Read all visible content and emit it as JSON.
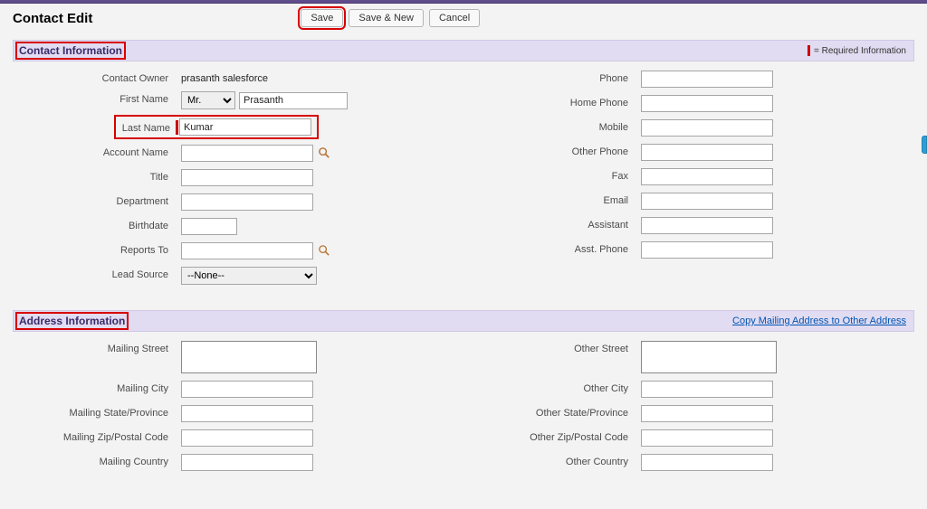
{
  "page": {
    "title": "Contact Edit"
  },
  "buttons": {
    "save": "Save",
    "save_new": "Save & New",
    "cancel": "Cancel"
  },
  "sections": {
    "contact_info": "Contact Information",
    "address_info": "Address Information",
    "required_legend": "= Required Information",
    "copy_link": "Copy Mailing Address to Other Address"
  },
  "labels": {
    "contact_owner": "Contact Owner",
    "first_name": "First Name",
    "last_name": "Last Name",
    "account_name": "Account Name",
    "title": "Title",
    "department": "Department",
    "birthdate": "Birthdate",
    "reports_to": "Reports To",
    "lead_source": "Lead Source",
    "phone": "Phone",
    "home_phone": "Home Phone",
    "mobile": "Mobile",
    "other_phone": "Other Phone",
    "fax": "Fax",
    "email": "Email",
    "assistant": "Assistant",
    "asst_phone": "Asst. Phone",
    "mailing_street": "Mailing Street",
    "mailing_city": "Mailing City",
    "mailing_state": "Mailing State/Province",
    "mailing_zip": "Mailing Zip/Postal Code",
    "mailing_country": "Mailing Country",
    "other_street": "Other Street",
    "other_city": "Other City",
    "other_state": "Other State/Province",
    "other_zip": "Other Zip/Postal Code",
    "other_country": "Other Country"
  },
  "values": {
    "contact_owner": "prasanth salesforce",
    "salutation": "Mr.",
    "first_name": "Prasanth",
    "last_name": "Kumar",
    "account_name": "",
    "title": "",
    "department": "",
    "birthdate": "",
    "reports_to": "",
    "lead_source": "--None--",
    "phone": "",
    "home_phone": "",
    "mobile": "",
    "other_phone": "",
    "fax": "",
    "email": "",
    "assistant": "",
    "asst_phone": "",
    "mailing_street": "",
    "mailing_city": "",
    "mailing_state": "",
    "mailing_zip": "",
    "mailing_country": "",
    "other_street": "",
    "other_city": "",
    "other_state": "",
    "other_zip": "",
    "other_country": ""
  }
}
